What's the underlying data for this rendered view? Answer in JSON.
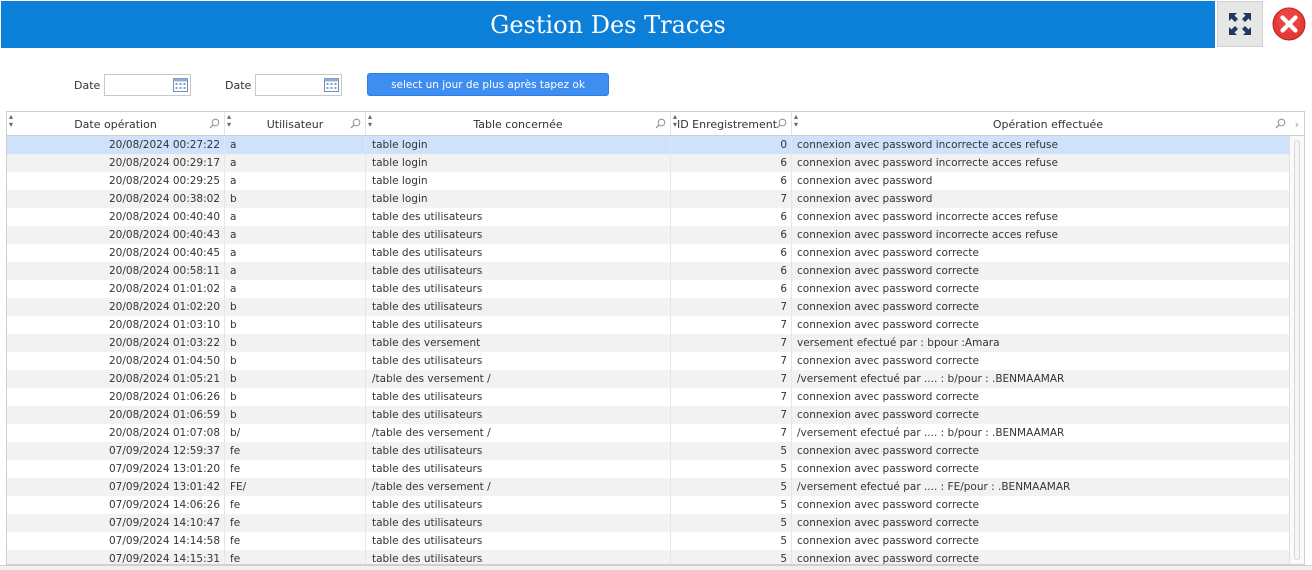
{
  "window": {
    "title": "Gestion Des Traces",
    "expand_icon": "expand-arrows-icon",
    "close_icon": "close-circle-icon",
    "accent": "#0c7fd8",
    "close_color": "#e53935"
  },
  "filters": {
    "date1_label": "Date",
    "date1_value": "",
    "date2_label": "Date",
    "date2_value": "",
    "calendar_icon": "calendar-icon",
    "ok_button": "select un jour de plus  après  tapez  ok",
    "button_color": "#3d8ef0"
  },
  "table": {
    "columns": [
      "Date opération",
      "Utilisateur",
      "Table concernée",
      "ID Enregistrement",
      "Opération effectuée"
    ],
    "selected_row": 0,
    "rows": [
      [
        "20/08/2024 00:27:22",
        "a",
        "table login",
        "0",
        "connexion avec password incorrecte acces refuse"
      ],
      [
        "20/08/2024 00:29:17",
        "a",
        "table login",
        "6",
        "connexion avec password incorrecte acces refuse"
      ],
      [
        "20/08/2024 00:29:25",
        "a",
        "table login",
        "6",
        "connexion avec password"
      ],
      [
        "20/08/2024 00:38:02",
        "b",
        "table login",
        "7",
        "connexion avec password"
      ],
      [
        "20/08/2024 00:40:40",
        "a",
        "table des utilisateurs",
        "6",
        "connexion avec password incorrecte acces refuse"
      ],
      [
        "20/08/2024 00:40:43",
        "a",
        "table des utilisateurs",
        "6",
        "connexion avec password incorrecte acces refuse"
      ],
      [
        "20/08/2024 00:40:45",
        "a",
        "table des utilisateurs",
        "6",
        "connexion avec password correcte"
      ],
      [
        "20/08/2024 00:58:11",
        "a",
        "table des utilisateurs",
        "6",
        "connexion avec password correcte"
      ],
      [
        "20/08/2024 01:01:02",
        "a",
        "table des utilisateurs",
        "6",
        "connexion avec password correcte"
      ],
      [
        "20/08/2024 01:02:20",
        "b",
        "table des utilisateurs",
        "7",
        "connexion avec password correcte"
      ],
      [
        "20/08/2024 01:03:10",
        "b",
        "table des utilisateurs",
        "7",
        "connexion avec password correcte"
      ],
      [
        "20/08/2024 01:03:22",
        "b",
        "table des versement",
        "7",
        "versement efectué par : bpour :Amara"
      ],
      [
        "20/08/2024 01:04:50",
        "b",
        "table des utilisateurs",
        "7",
        "connexion avec password correcte"
      ],
      [
        "20/08/2024 01:05:21",
        "b",
        "/table des versement /",
        "7",
        "/versement efectué par  .... : b/pour : .BENMAAMAR"
      ],
      [
        "20/08/2024 01:06:26",
        "b",
        "table des utilisateurs",
        "7",
        "connexion avec password correcte"
      ],
      [
        "20/08/2024 01:06:59",
        "b",
        "table des utilisateurs",
        "7",
        "connexion avec password correcte"
      ],
      [
        "20/08/2024 01:07:08",
        "b/",
        "/table des versement /",
        "7",
        "/versement efectué par  .... : b/pour : .BENMAAMAR"
      ],
      [
        "07/09/2024 12:59:37",
        "fe",
        "table des utilisateurs",
        "5",
        "connexion avec password correcte"
      ],
      [
        "07/09/2024 13:01:20",
        "fe",
        "table des utilisateurs",
        "5",
        "connexion avec password correcte"
      ],
      [
        "07/09/2024 13:01:42",
        "FE/",
        "/table des versement /",
        "5",
        "/versement efectué par  .... : FE/pour : .BENMAAMAR"
      ],
      [
        "07/09/2024 14:06:26",
        "fe",
        "table des utilisateurs",
        "5",
        "connexion avec password correcte"
      ],
      [
        "07/09/2024 14:10:47",
        "fe",
        "table des utilisateurs",
        "5",
        "connexion avec password correcte"
      ],
      [
        "07/09/2024 14:14:58",
        "fe",
        "table des utilisateurs",
        "5",
        "connexion avec password correcte"
      ],
      [
        "07/09/2024 14:15:31",
        "fe",
        "table des utilisateurs",
        "5",
        "connexion avec password correcte"
      ]
    ]
  }
}
